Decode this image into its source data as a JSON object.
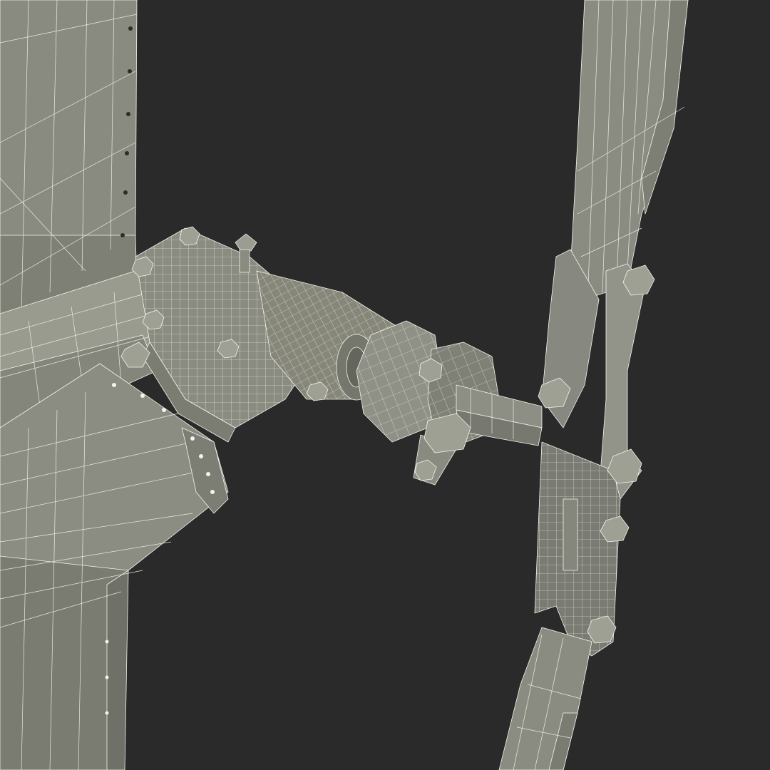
{
  "scene": {
    "background_color": "#2a2a2a",
    "wireframe_color": "#f4f4ee",
    "surface_color": "#8a8b80",
    "shadow_color": "#6d6e65",
    "highlight_color": "#a3a498"
  }
}
